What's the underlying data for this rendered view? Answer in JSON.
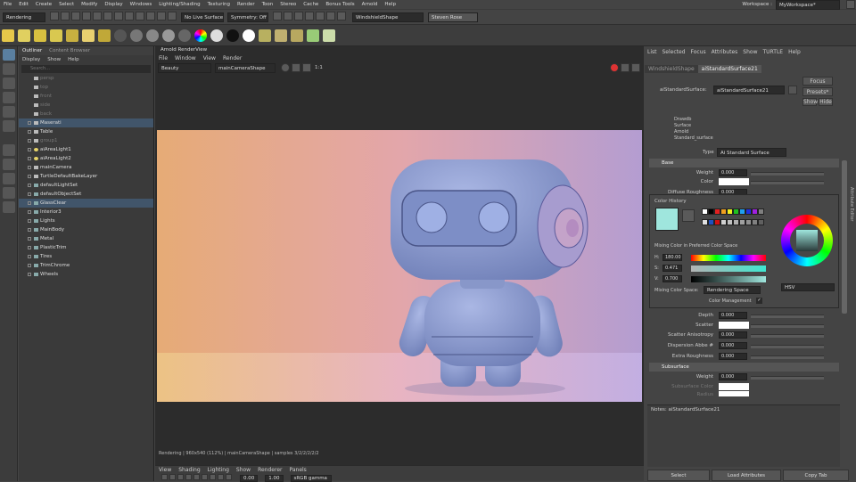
{
  "menubar": {
    "items": [
      "File",
      "Edit",
      "Create",
      "Select",
      "Modify",
      "Display",
      "Windows",
      "Lighting/Shading",
      "Texturing",
      "Render",
      "Toon",
      "Stereo",
      "Cache",
      "Bonus Tools",
      "Arnold",
      "Help"
    ],
    "workspace_label": "Workspace :",
    "workspace_value": "MyWorkspace*"
  },
  "status": {
    "mode": "Rendering",
    "live_surface": "No Live Surface",
    "symmetry": "Symmetry: Off",
    "search_value": "WindshieldShape",
    "user": "Steven Rose"
  },
  "outliner": {
    "tabs": [
      "Outliner",
      "Content Browser"
    ],
    "menu": [
      "Display",
      "Show",
      "Help"
    ],
    "search_placeholder": "Search...",
    "items": [
      {
        "label": "persp",
        "dim": true,
        "icon": "camera-icon"
      },
      {
        "label": "top",
        "dim": true,
        "icon": "camera-icon"
      },
      {
        "label": "front",
        "dim": true,
        "icon": "camera-icon"
      },
      {
        "label": "side",
        "dim": true,
        "icon": "camera-icon"
      },
      {
        "label": "back",
        "dim": true,
        "icon": "camera-icon"
      },
      {
        "label": "Maserati",
        "sel": true,
        "icon": "group-icon"
      },
      {
        "label": "Table",
        "icon": "group-icon"
      },
      {
        "label": "group1",
        "dim": true,
        "icon": "group-icon"
      },
      {
        "label": "aiAreaLight1",
        "icon": "light-icon"
      },
      {
        "label": "aiAreaLight2",
        "icon": "light-icon"
      },
      {
        "label": "mainCamera",
        "icon": "camera-icon"
      },
      {
        "label": "TurtleDefaultBakeLayer",
        "icon": "layer-icon"
      },
      {
        "label": "defaultLightSet",
        "icon": "set-icon"
      },
      {
        "label": "defaultObjectSet",
        "icon": "set-icon"
      },
      {
        "label": "GlassClear",
        "sel": true,
        "icon": "shading-group-icon"
      },
      {
        "label": "Interior3",
        "icon": "shading-group-icon"
      },
      {
        "label": "Lights",
        "icon": "shading-group-icon"
      },
      {
        "label": "MainBody",
        "icon": "shading-group-icon"
      },
      {
        "label": "Metal",
        "icon": "shading-group-icon"
      },
      {
        "label": "PlasticTrim",
        "icon": "shading-group-icon"
      },
      {
        "label": "Tires",
        "icon": "shading-group-icon"
      },
      {
        "label": "TrimChrome",
        "icon": "shading-group-icon"
      },
      {
        "label": "Wheels",
        "icon": "shading-group-icon"
      }
    ]
  },
  "renderview": {
    "title": "Arnold RenderView",
    "menu": [
      "File",
      "Window",
      "View",
      "Render"
    ],
    "display": "Beauty",
    "camera": "mainCameraShape",
    "ratio": "1:1",
    "status": "Rendering | 960x540 (112%) | mainCameraShape | samples 3/2/2/2/2/2"
  },
  "viewport": {
    "menu": [
      "View",
      "Shading",
      "Lighting",
      "Show",
      "Renderer",
      "Panels"
    ],
    "exposure": "0.00",
    "gamma": "1.00",
    "colorspace": "sRGB gamma"
  },
  "attr": {
    "menu": [
      "List",
      "Selected",
      "Focus",
      "Attributes",
      "Show",
      "TURTLE",
      "Help"
    ],
    "tabs": [
      "WindshieldShape",
      "aiStandardSurface21"
    ],
    "node_label": "aiStandardSurface:",
    "node_value": "aiStandardSurface21",
    "focus": "Focus",
    "presets": "Presets*",
    "show": "Show",
    "hide": "Hide",
    "sample_lines": [
      "Drawdb",
      "Surface",
      "Arnold",
      "Standard_surface"
    ],
    "type_label": "Type",
    "type_value": "Ai Standard Surface",
    "base_header": "Base",
    "weight_label": "Weight",
    "weight_value": "0.000",
    "color_label": "Color",
    "diffuse_label": "Diffuse Roughness",
    "diffuse_value": "0.000",
    "depth_label": "Depth",
    "depth_value": "0.000",
    "scatter_label": "Scatter",
    "scatter_aniso_label": "Scatter Anisotropy",
    "scatter_aniso_value": "0.000",
    "dispersion_label": "Dispersion Abbe #",
    "dispersion_value": "0.000",
    "extra_label": "Extra Roughness",
    "extra_value": "0.000",
    "subsurface_header": "Subsurface",
    "sub_weight_label": "Weight",
    "sub_weight_value": "0.000",
    "sub_color_label": "Subsurface Color",
    "sub_radius_label": "Radius",
    "notes": "Notes:  aiStandardSurface21",
    "select_btn": "Select",
    "load_btn": "Load Attributes",
    "copy_btn": "Copy Tab",
    "side_tab": "Attribute Editor"
  },
  "colorpicker": {
    "title": "Color History",
    "mixing_title": "Mixing Color in Preferred Color Space",
    "h_label": "H:",
    "h_value": "180.00",
    "s_label": "S:",
    "s_value": "0.471",
    "v_label": "V:",
    "v_value": "0.700",
    "space_label": "Mixing Color Space:",
    "space_value": "Rendering Space",
    "mgmt_label": "Color Management",
    "mode_value": "HSV",
    "history": [
      "#ffffff",
      "#000000",
      "#e02020",
      "#f0a020",
      "#f0f020",
      "#20c020",
      "#20a0f0",
      "#2030e0",
      "#a020e0",
      "#7f7f7f",
      "#e0e0e0",
      "#2050c0",
      "#d01010",
      "#d0d0d0",
      "#c0c0c0",
      "#b0b0b0",
      "#a0a0a0",
      "#909090",
      "#808080",
      "#606060"
    ],
    "current": "#9fe6dd"
  },
  "colors": {
    "accent": "#41556a",
    "bg": "#444444"
  }
}
